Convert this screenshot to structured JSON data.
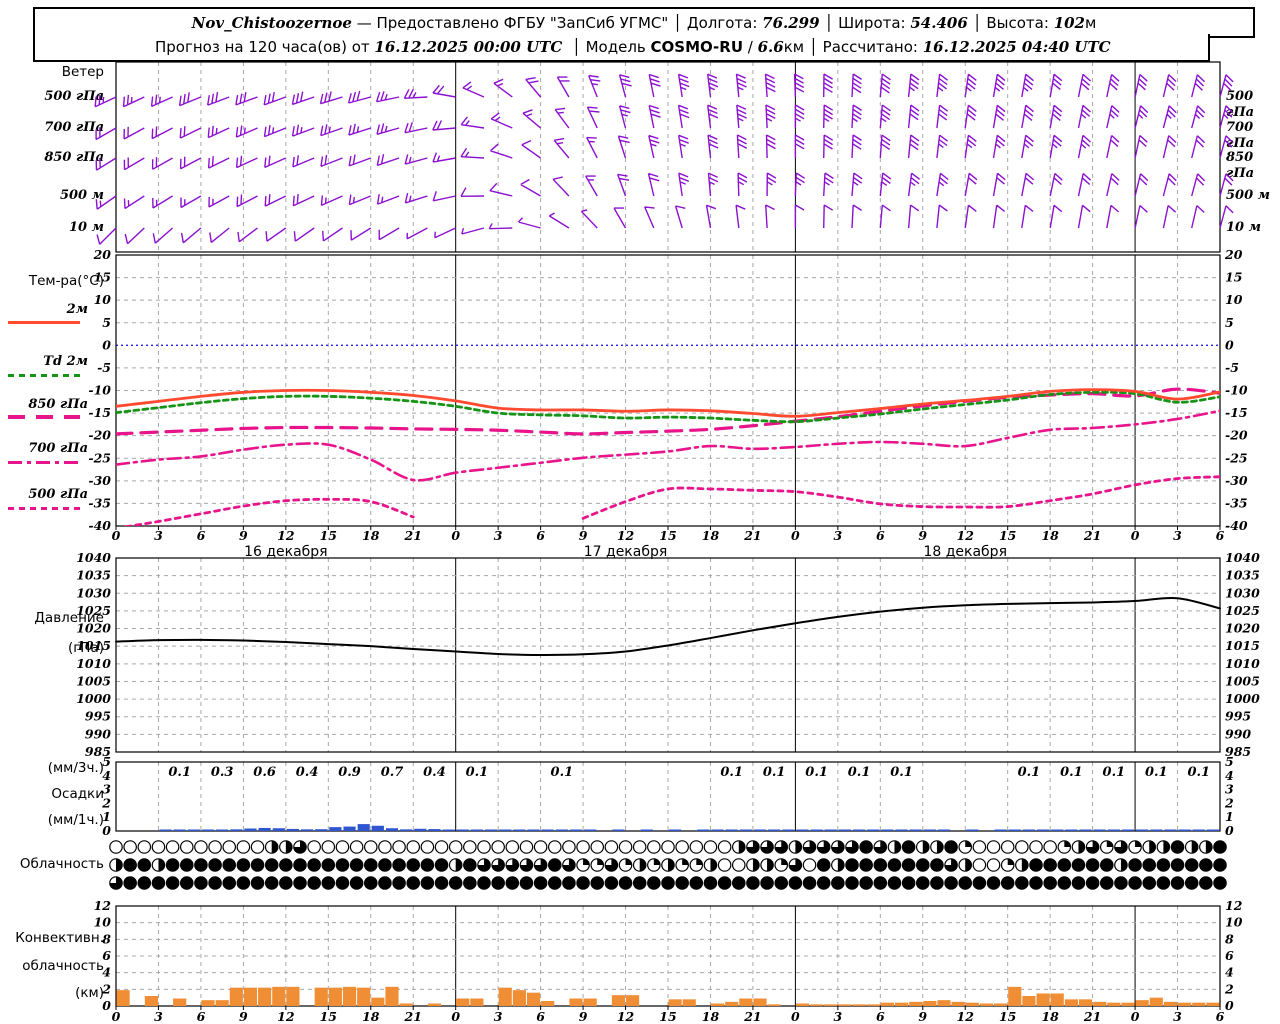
{
  "header": {
    "row1": [
      {
        "t": "Nov_Chistoozernoe",
        "s": "bi"
      },
      {
        "t": " — Предоставлено ФГБУ \"ЗапСиб УГМС\" ",
        "s": ""
      },
      {
        "t": "│ Долгота: ",
        "s": ""
      },
      {
        "t": "76.299",
        "s": "bi"
      },
      {
        "t": " │ Широта: ",
        "s": ""
      },
      {
        "t": "54.406",
        "s": "bi"
      },
      {
        "t": " │ Высота: ",
        "s": ""
      },
      {
        "t": "102",
        "s": "bi"
      },
      {
        "t": "м",
        "s": ""
      }
    ],
    "row2": [
      {
        "t": "Прогноз на 120 часа(ов) от ",
        "s": ""
      },
      {
        "t": "16.12.2025 00:00 UTC",
        "s": "bi"
      },
      {
        "t": "  │ Модель ",
        "s": ""
      },
      {
        "t": "COSMO-RU",
        "s": "b"
      },
      {
        "t": " / ",
        "s": ""
      },
      {
        "t": "6.6",
        "s": "bi"
      },
      {
        "t": "км │ Рассчитано: ",
        "s": ""
      },
      {
        "t": "16.12.2025 04:40 UTC",
        "s": "bi"
      }
    ]
  },
  "left": {
    "wind_title": "Ветер",
    "temp_title": "Тем-ра(°C)",
    "pressure_title1": "Давление",
    "pressure_title2": "(гПа)",
    "precip_title1": "(мм/3ч.)",
    "precip_title2": "Осадки",
    "precip_title3": "(мм/1ч.)",
    "clouds_title": "Облачность",
    "conv_title1": "Конвективн.",
    "conv_title2": "облачность",
    "conv_title3": "(км)"
  },
  "wind_levels": [
    "500 гПа",
    "700 гПа",
    "850 гПа",
    "500 м",
    "10 м"
  ],
  "temp_legend": [
    "2м",
    "Td  2м",
    "850 гПа",
    "700 гПа",
    "500 гПа"
  ],
  "colors": {
    "barb_purple": "#8c10d0",
    "temp_red": "#ff4a30",
    "dew_green": "#169416",
    "magenta": "#e8148c",
    "zero_line_blue": "#2222ee",
    "pressure_black": "#000000",
    "precip_blue": "#2f55cf",
    "conv_orange": "#ef8e35",
    "grid_gray": "#a8a8a8"
  },
  "chart_data": {
    "type": "line",
    "hours_total": 78,
    "x_step_hours": 3,
    "x_tick_labels": [
      "0",
      "3",
      "6",
      "9",
      "12",
      "15",
      "18",
      "21",
      "0",
      "3",
      "6",
      "9",
      "12",
      "15",
      "18",
      "21",
      "0",
      "3",
      "6",
      "9",
      "12",
      "15",
      "18",
      "21",
      "0",
      "3",
      "6"
    ],
    "dates": [
      {
        "label": "16 декабря",
        "hour": 12
      },
      {
        "label": "17 декабря",
        "hour": 36
      },
      {
        "label": "18 декабря",
        "hour": 60
      }
    ],
    "temperature": {
      "ylabel": "Тем-ра(°C)",
      "ylim": [
        -40,
        20
      ],
      "yticks": [
        20,
        15,
        10,
        5,
        0,
        -5,
        -10,
        -15,
        -20,
        -25,
        -30,
        -35,
        -40
      ],
      "series": [
        {
          "name": "2м",
          "values": [
            -13.5,
            -12.4,
            -11.3,
            -10.4,
            -10.0,
            -10.0,
            -10.4,
            -11.1,
            -12.3,
            -13.9,
            -14.3,
            -14.3,
            -14.6,
            -14.3,
            -14.5,
            -15.1,
            -15.7,
            -14.9,
            -14.0,
            -13.0,
            -12.2,
            -11.3,
            -10.2,
            -9.8,
            -10.2,
            -11.9,
            -10.3
          ]
        },
        {
          "name": "Td 2м",
          "values": [
            -14.9,
            -13.8,
            -12.7,
            -11.8,
            -11.3,
            -11.3,
            -11.7,
            -12.4,
            -13.5,
            -15.0,
            -15.4,
            -15.6,
            -16.1,
            -15.9,
            -16.1,
            -16.6,
            -16.9,
            -16.1,
            -15.2,
            -14.1,
            -13.1,
            -12.1,
            -10.9,
            -10.4,
            -10.7,
            -12.6,
            -11.4
          ]
        },
        {
          "name": "850 гПа",
          "values": [
            -19.6,
            -19.2,
            -18.8,
            -18.4,
            -18.2,
            -18.2,
            -18.3,
            -18.5,
            -18.6,
            -18.8,
            -19.2,
            -19.6,
            -19.3,
            -19.0,
            -18.6,
            -17.8,
            -16.8,
            -15.8,
            -14.6,
            -13.4,
            -12.4,
            -11.5,
            -11.0,
            -10.7,
            -11.2,
            -9.7,
            -10.6
          ]
        },
        {
          "name": "700 гПа",
          "values": [
            -26.4,
            -25.3,
            -24.6,
            -23.1,
            -22.0,
            -22.0,
            -25.3,
            -29.8,
            -28.2,
            -27.1,
            -26.0,
            -24.9,
            -24.2,
            -23.5,
            -22.3,
            -22.9,
            -22.5,
            -21.8,
            -21.4,
            -21.8,
            -22.3,
            -20.5,
            -18.7,
            -18.3,
            -17.5,
            -16.3,
            -14.5
          ]
        },
        {
          "name": "500 гПа",
          "values": [
            -40.5,
            -39.0,
            -37.3,
            -35.6,
            -34.4,
            -34.1,
            -34.6,
            -38.0,
            null,
            null,
            null,
            -38.3,
            -34.6,
            -31.8,
            -31.8,
            -32.1,
            -32.4,
            -33.6,
            -35.1,
            -35.7,
            -35.8,
            -35.7,
            -34.4,
            -32.9,
            -30.9,
            -29.5,
            -29.1
          ]
        }
      ]
    },
    "pressure": {
      "ylabel": "Давление (гПа)",
      "ylim": [
        985,
        1040
      ],
      "yticks": [
        1040,
        1035,
        1030,
        1025,
        1020,
        1015,
        1010,
        1005,
        1000,
        995,
        990,
        985
      ],
      "values": [
        1016.3,
        1016.7,
        1016.8,
        1016.6,
        1016.2,
        1015.6,
        1015.0,
        1014.2,
        1013.5,
        1012.8,
        1012.5,
        1012.7,
        1013.5,
        1015.2,
        1017.3,
        1019.5,
        1021.5,
        1023.3,
        1024.8,
        1025.9,
        1026.6,
        1027.0,
        1027.2,
        1027.4,
        1027.8,
        1028.6,
        1025.7
      ]
    },
    "precipitation": {
      "ylabel": "Осадки (мм/3ч., мм/1ч.)",
      "ylim": [
        0,
        5
      ],
      "yticks": [
        5,
        4,
        3,
        2,
        1,
        0
      ],
      "labels_3h": [
        "",
        "0.1",
        "0.3",
        "0.6",
        "0.4",
        "0.9",
        "0.7",
        "0.4",
        "0.1",
        "",
        "0.1",
        "",
        "",
        "",
        "0.1",
        "0.1",
        "0.1",
        "0.1",
        "0.1",
        "",
        "",
        "0.1",
        "0.1",
        "0.1",
        "0.1",
        "0.1"
      ],
      "hourly": [
        0,
        0,
        0,
        0.02,
        0.03,
        0.05,
        0.08,
        0.1,
        0.12,
        0.18,
        0.22,
        0.2,
        0.15,
        0.12,
        0.13,
        0.28,
        0.32,
        0.5,
        0.38,
        0.2,
        0.12,
        0.16,
        0.14,
        0.1,
        0.05,
        0.03,
        0.02,
        0.01,
        0.01,
        0.01,
        0.03,
        0.04,
        0.03,
        0.01,
        0,
        0.01,
        0,
        0.01,
        0,
        0.01,
        0,
        0.01,
        0.03,
        0.04,
        0.03,
        0.04,
        0.03,
        0.03,
        0.03,
        0.05,
        0.03,
        0.04,
        0.03,
        0.03,
        0.04,
        0.03,
        0.03,
        0.01,
        0.01,
        0,
        0.01,
        0,
        0.01,
        0.03,
        0.04,
        0.03,
        0.03,
        0.04,
        0.03,
        0.04,
        0.03,
        0.03,
        0.03,
        0.04,
        0.03,
        0.04,
        0.05,
        0.06
      ]
    },
    "cloudiness": {
      "rows_quarters_filled": [
        "0000000000022300000000000000000000000000000023332333343242241000000123131224224",
        "2442444444444444444444442433333431131212112002213042444444432001244444424444444",
        "3444444444444444444444444444444444444444444444444444444444444444444444444444444"
      ]
    },
    "convective_clouds": {
      "ylabel": "Конвективн. облачность (км)",
      "ylim": [
        0,
        12
      ],
      "yticks": [
        12,
        10,
        8,
        6,
        4,
        2,
        0
      ],
      "hourly_km": [
        1.9,
        0,
        1.2,
        0,
        0.9,
        0,
        0.7,
        0.7,
        2.2,
        2.2,
        2.2,
        2.3,
        2.3,
        0,
        2.2,
        2.2,
        2.3,
        2.2,
        1.0,
        2.3,
        0.3,
        0,
        0.3,
        0,
        0.9,
        0.9,
        0,
        2.2,
        1.9,
        1.6,
        0.6,
        0,
        0.9,
        0.9,
        0,
        1.3,
        1.3,
        0,
        0,
        0.8,
        0.8,
        0,
        0.3,
        0.5,
        0.9,
        0.9,
        0.2,
        0,
        0.3,
        0.2,
        0.2,
        0.2,
        0.2,
        0.2,
        0.4,
        0.4,
        0.5,
        0.6,
        0.7,
        0.5,
        0.4,
        0.3,
        0.3,
        2.3,
        1.2,
        1.5,
        1.5,
        0.8,
        0.8,
        0.5,
        0.4,
        0.4,
        0.7,
        1.0,
        0.5,
        0.4,
        0.4,
        0.4
      ]
    },
    "wind": {
      "levels": [
        {
          "name": "500 гПа",
          "dir_from_deg": [
            245,
            245,
            248,
            250,
            250,
            252,
            255,
            260,
            280,
            300,
            320,
            335,
            345,
            350,
            353,
            355,
            358,
            2,
            5,
            6,
            8,
            10,
            10,
            12,
            12,
            14,
            15
          ],
          "speed_kt": [
            25,
            25,
            28,
            28,
            30,
            30,
            28,
            25,
            20,
            15,
            18,
            22,
            28,
            32,
            35,
            38,
            38,
            40,
            38,
            35,
            35,
            33,
            32,
            30,
            30,
            28,
            28
          ]
        },
        {
          "name": "700 гПа",
          "dir_from_deg": [
            240,
            242,
            244,
            246,
            248,
            250,
            252,
            255,
            265,
            285,
            310,
            330,
            345,
            350,
            353,
            356,
            0,
            2,
            5,
            6,
            8,
            10,
            10,
            12,
            14,
            15,
            15
          ],
          "speed_kt": [
            20,
            22,
            22,
            24,
            25,
            25,
            24,
            22,
            18,
            15,
            15,
            18,
            25,
            30,
            32,
            35,
            35,
            35,
            33,
            32,
            30,
            30,
            28,
            26,
            25,
            25,
            24
          ]
        },
        {
          "name": "850 гПа",
          "dir_from_deg": [
            238,
            240,
            242,
            245,
            246,
            248,
            250,
            252,
            260,
            280,
            305,
            328,
            342,
            350,
            354,
            358,
            0,
            2,
            4,
            6,
            8,
            10,
            10,
            12,
            12,
            14,
            15
          ],
          "speed_kt": [
            18,
            20,
            20,
            22,
            22,
            22,
            20,
            18,
            15,
            12,
            12,
            15,
            20,
            25,
            28,
            30,
            30,
            30,
            28,
            28,
            26,
            25,
            24,
            22,
            22,
            20,
            20
          ]
        },
        {
          "name": "500 м",
          "dir_from_deg": [
            235,
            238,
            240,
            242,
            244,
            245,
            248,
            250,
            258,
            275,
            300,
            325,
            340,
            350,
            355,
            0,
            2,
            4,
            6,
            8,
            10,
            10,
            12,
            12,
            14,
            15,
            15
          ],
          "speed_kt": [
            15,
            16,
            16,
            18,
            18,
            18,
            16,
            15,
            12,
            10,
            10,
            12,
            18,
            22,
            25,
            26,
            26,
            26,
            25,
            24,
            22,
            22,
            20,
            20,
            18,
            18,
            18
          ]
        },
        {
          "name": "10 м",
          "dir_from_deg": [
            225,
            228,
            230,
            232,
            235,
            235,
            238,
            240,
            245,
            260,
            285,
            310,
            330,
            340,
            350,
            355,
            0,
            2,
            5,
            5,
            8,
            8,
            10,
            10,
            12,
            12,
            15
          ],
          "speed_kt": [
            8,
            8,
            10,
            10,
            10,
            10,
            8,
            8,
            6,
            5,
            5,
            6,
            8,
            10,
            12,
            12,
            12,
            12,
            10,
            10,
            10,
            8,
            8,
            8,
            8,
            10,
            10
          ]
        }
      ]
    }
  }
}
